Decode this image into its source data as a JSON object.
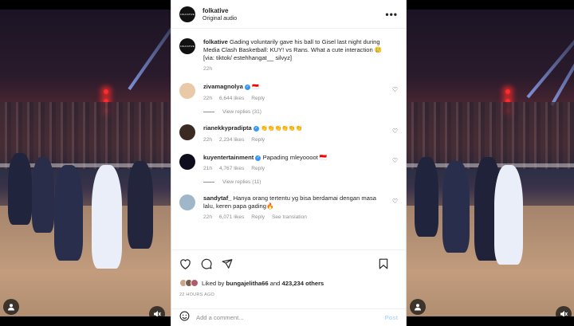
{
  "header": {
    "username": "folkative",
    "subtitle": "Original audio",
    "avatar_text": "FOLKATIVE"
  },
  "caption": {
    "username": "folkative",
    "text": "Gading voluntarily gave his ball to Gisel last night during Media Clash Basketball: KUY! vs Rans. What a cute interaction 🥲",
    "via": "[via: tiktok/ estehhangat__ silvyz]",
    "time": "22h"
  },
  "comments": [
    {
      "username": "zivamagnolya",
      "verified": true,
      "text": "🇮🇩",
      "time": "22h",
      "likes": "6,644 likes",
      "reply": "Reply",
      "view_replies": "View replies (31)",
      "avatar_color": "#e8c9a8"
    },
    {
      "username": "rianekkypradipta",
      "verified": true,
      "text": "👏👏👏👏👏👏",
      "time": "22h",
      "likes": "2,234 likes",
      "reply": "Reply",
      "view_replies": "",
      "avatar_color": "#3a2a22"
    },
    {
      "username": "kuyentertainment",
      "verified": true,
      "text": "Papading mleyoooot 🇮🇩",
      "time": "21h",
      "likes": "4,767 likes",
      "reply": "Reply",
      "view_replies": "View replies (11)",
      "avatar_color": "#0d0d1e"
    },
    {
      "username": "sandytaf_",
      "verified": false,
      "text": "Hanya orang tertentu yg bisa berdamai dengan masa lalu, keren papa gading🔥",
      "time": "22h",
      "likes": "6,071 likes",
      "reply": "Reply",
      "view_replies": "See translation",
      "avatar_color": "#9fb7c9"
    }
  ],
  "likes": {
    "prefix": "Liked by",
    "user": "bungajelitha66",
    "and": "and",
    "others": "423,234 others"
  },
  "timestamp": "22 HOURS AGO",
  "add_comment": {
    "placeholder": "Add a comment...",
    "post_label": "Post"
  },
  "icons": [
    "heart-icon",
    "comment-icon",
    "share-icon",
    "bookmark-icon",
    "emoji-icon",
    "more-icon",
    "user-icon",
    "mute-icon"
  ]
}
